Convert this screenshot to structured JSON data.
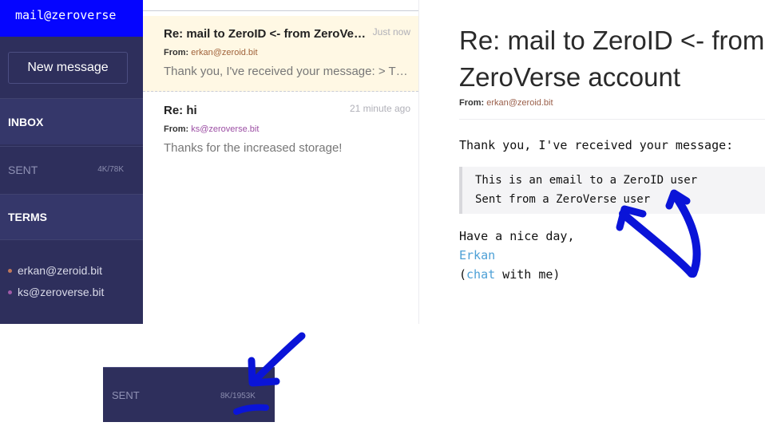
{
  "sidebar": {
    "account": "mail@zeroverse",
    "new_message_label": "New message",
    "nav": [
      {
        "label": "INBOX",
        "count": ""
      },
      {
        "label": "SENT",
        "count": "4K/78K"
      },
      {
        "label": "TERMS",
        "count": ""
      }
    ],
    "contacts": [
      {
        "address": "erkan@zeroid.bit",
        "color": "#c0785a"
      },
      {
        "address": "ks@zeroverse.bit",
        "color": "#a05aa8"
      }
    ]
  },
  "messages": [
    {
      "subject": "Re: mail to ZeroID <- from ZeroVerse account",
      "time": "Just now",
      "from_label": "From:",
      "from": "erkan@zeroid.bit",
      "from_color": "#a0623a",
      "preview": "Thank you, I've received your message: > This is an email to a ZeroID user"
    },
    {
      "subject": "Re: hi",
      "time": "21 minute ago",
      "from_label": "From:",
      "from": "ks@zeroverse.bit",
      "from_color": "#9c4fa4",
      "preview": "Thanks for the increased storage!"
    }
  ],
  "reader": {
    "title": "Re: mail to ZeroID <- from ZeroVerse account",
    "from_label": "From:",
    "from": "erkan@zeroid.bit",
    "intro": "Thank you, I've received your message:",
    "quote": [
      "This is an email to a ZeroID user",
      "Sent from a ZeroVerse user"
    ],
    "closing": "Have a nice day,",
    "signature_link": "Erkan",
    "chat_open": "(",
    "chat_link": "chat",
    "chat_close": " with me)"
  },
  "inset": {
    "label": "SENT",
    "count": "8K/1953K"
  },
  "colors": {
    "sidebar_bg": "#2e2f5c",
    "header_bg": "#0505ff",
    "selected_bg": "#fff8e4",
    "link": "#4da0d6",
    "annotation": "#0a14d8"
  }
}
